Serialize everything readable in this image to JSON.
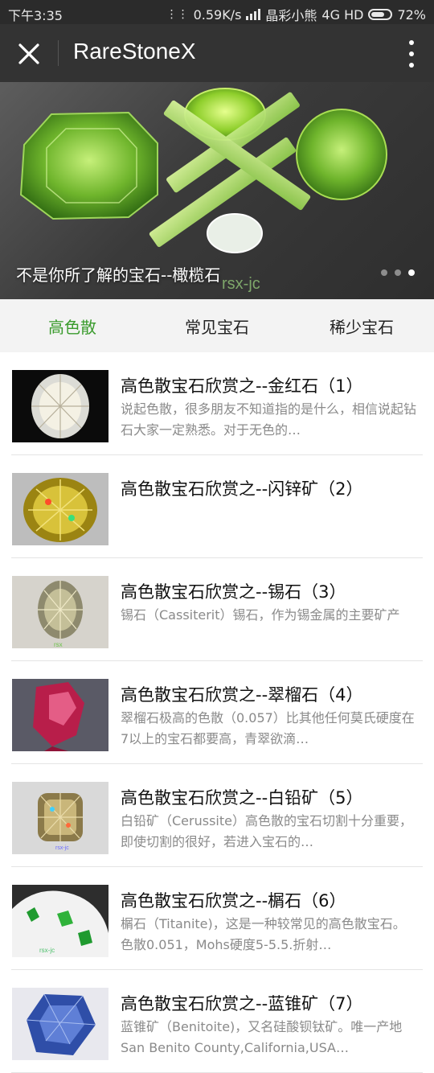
{
  "status": {
    "time": "下午3:35",
    "speed": "0.59K/s",
    "carrier": "晶彩小熊",
    "network": "4G HD",
    "battery": "72%",
    "battery_level": 0.72
  },
  "header": {
    "title": "RareStoneX"
  },
  "banner": {
    "caption": "不是你所了解的宝石--橄榄石",
    "watermark": "rsx-jc",
    "slide_count": 3,
    "active_slide": 2
  },
  "tabs": [
    {
      "label": "高色散",
      "active": true
    },
    {
      "label": "常见宝石",
      "active": false
    },
    {
      "label": "稀少宝石",
      "active": false
    }
  ],
  "articles": [
    {
      "title": "高色散宝石欣赏之--金红石（1）",
      "desc": "说起色散，很多朋友不知道指的是什么，相信说起钻石大家一定熟悉。对于无色的…",
      "thumb": "clear-oval-gem"
    },
    {
      "title": "高色散宝石欣赏之--闪锌矿（2）",
      "desc": "",
      "thumb": "yellow-oval-gem"
    },
    {
      "title": "高色散宝石欣赏之--锡石（3）",
      "desc": "锡石（Cassiterit）锡石，作为锡金属的主要矿产",
      "thumb": "grey-oval-gem"
    },
    {
      "title": "高色散宝石欣赏之--翠榴石（4）",
      "desc": "翠榴石极高的色散（0.057）比其他任何莫氏硬度在7以上的宝石都要高，青翠欲滴…",
      "thumb": "red-crystal"
    },
    {
      "title": "高色散宝石欣赏之--白铅矿（5）",
      "desc": "白铅矿（Cerussite）高色散的宝石切割十分重要，即使切割的很好，若进入宝石的…",
      "thumb": "champagne-cushion-gem"
    },
    {
      "title": "高色散宝石欣赏之--榍石（6）",
      "desc": "榍石（Titanite)，这是一种较常见的高色散宝石。色散0.051，Mohs硬度5-5.5.折射…",
      "thumb": "green-gems-on-white"
    },
    {
      "title": "高色散宝石欣赏之--蓝锥矿（7）",
      "desc": "蓝锥矿（Benitoite)，又名硅酸钡钛矿。唯一产地San Benito County,California,USA…",
      "thumb": "blue-gem"
    }
  ],
  "colors": {
    "accent": "#3a9b2d",
    "appbar": "#333333",
    "tabbar": "#f3f3f3"
  }
}
